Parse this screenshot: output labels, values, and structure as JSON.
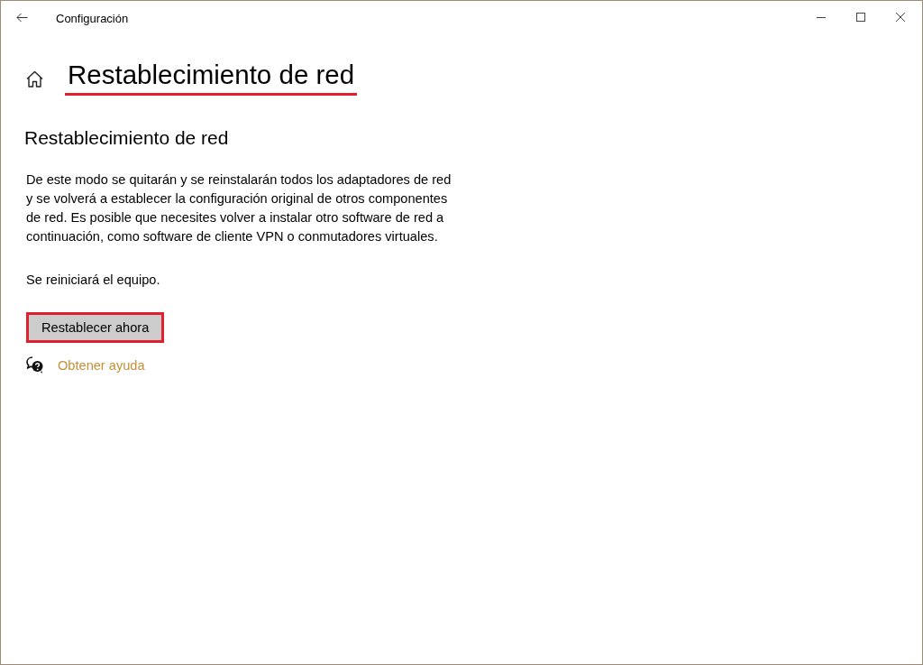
{
  "window": {
    "title": "Configuración"
  },
  "page_title": {
    "text": "Restablecimiento de red",
    "highlighted": true
  },
  "section": {
    "heading": "Restablecimiento de red",
    "description": "De este modo se quitarán y se reinstalarán todos los adaptadores de red y se volverá a establecer la configuración original de otros componentes de red. Es posible que necesites volver a instalar otro software de red a continuación, como software de cliente VPN o conmutadores virtuales.",
    "note": "Se reiniciará el equipo."
  },
  "button": {
    "label": "Restablecer ahora",
    "highlighted": true
  },
  "help_link": {
    "label": "Obtener ayuda"
  }
}
